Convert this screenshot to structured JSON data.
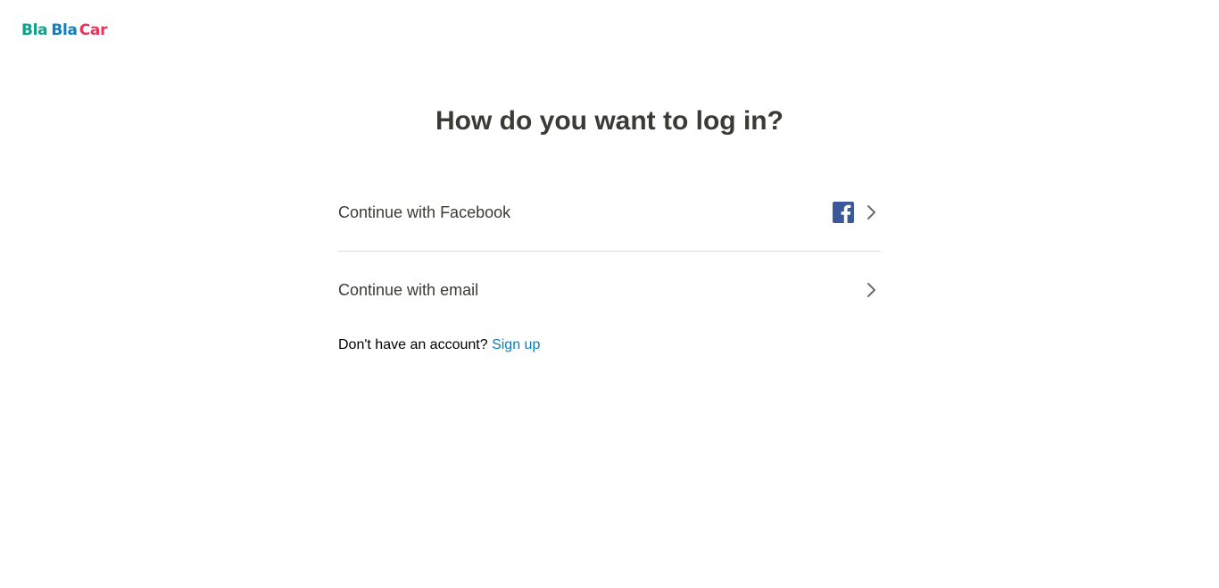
{
  "logo": {
    "word1": "Bla",
    "word2": "Bla",
    "word3": "Car",
    "colors": [
      "#0da08a",
      "#0b7fc0",
      "#e9355d"
    ]
  },
  "title": "How do you want to log in?",
  "options": [
    {
      "label": "Continue with Facebook",
      "icon": "facebook-icon",
      "chevron": "chevron-right-icon"
    },
    {
      "label": "Continue with email",
      "chevron": "chevron-right-icon"
    }
  ],
  "signup": {
    "prompt": "Don't have an account?",
    "link": "Sign up",
    "link_color": "#0a7fb5"
  },
  "colors": {
    "text": "#3b3b36",
    "divider": "#dddddd",
    "facebook": "#3b5998",
    "chevron": "#6b6b6b"
  }
}
